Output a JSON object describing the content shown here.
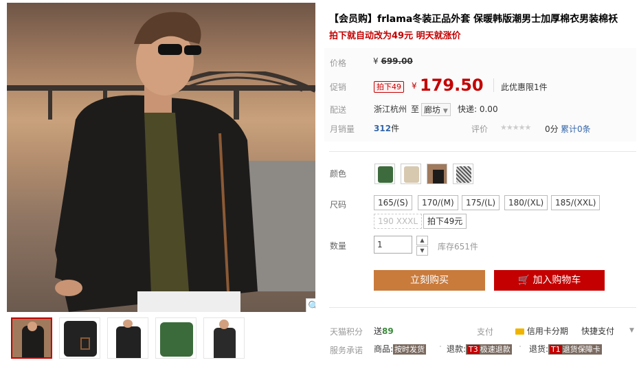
{
  "product": {
    "title": "【会员购】frlama冬装正品外套 保暖韩版潮男士加厚棉衣男装棉袄",
    "subtitle": "拍下就自动改为49元 明天就涨价"
  },
  "price": {
    "label": "价格",
    "currency": "¥",
    "original": "699.00"
  },
  "promo": {
    "label": "促销",
    "tag": "拍下49",
    "currency": "¥",
    "value": "179.50",
    "limit": "此优惠限1件"
  },
  "delivery": {
    "label": "配送",
    "from": "浙江杭州",
    "to_word": "至",
    "to_city": "廊坊",
    "express": "快递: 0.00"
  },
  "sales": {
    "label": "月销量",
    "count": "312",
    "unit": "件",
    "review_label": "评价",
    "score": "0分",
    "reviews": "累计0条"
  },
  "color": {
    "label": "颜色",
    "options": [
      "green",
      "beige",
      "black",
      "grey"
    ]
  },
  "size": {
    "label": "尺码",
    "options": [
      "165/(S)",
      "170/(M)",
      "175/(L)",
      "180/(XL)",
      "185/(XXL)",
      "190 XXXL",
      "拍下49元"
    ]
  },
  "quantity": {
    "label": "数量",
    "value": "1",
    "stock": "库存651件"
  },
  "actions": {
    "buy": "立刻购买",
    "cart": "加入购物车"
  },
  "points": {
    "label": "天猫积分",
    "send": "送",
    "value": "89",
    "pay_label": "支付",
    "credit": "信用卡分期",
    "express_pay": "快捷支付"
  },
  "service": {
    "label": "服务承诺",
    "goods_label": "商品:",
    "goods_tag": "按时发货",
    "refund_label": "退款:",
    "refund_code": "T3",
    "refund_tag": "极速退款",
    "return_label": "退货:",
    "return_code": "T1",
    "return_tag": "退货保障卡"
  },
  "colors": {
    "accent_red": "#c40000",
    "buy_orange": "#c97b3c",
    "link_blue": "#3366aa"
  }
}
